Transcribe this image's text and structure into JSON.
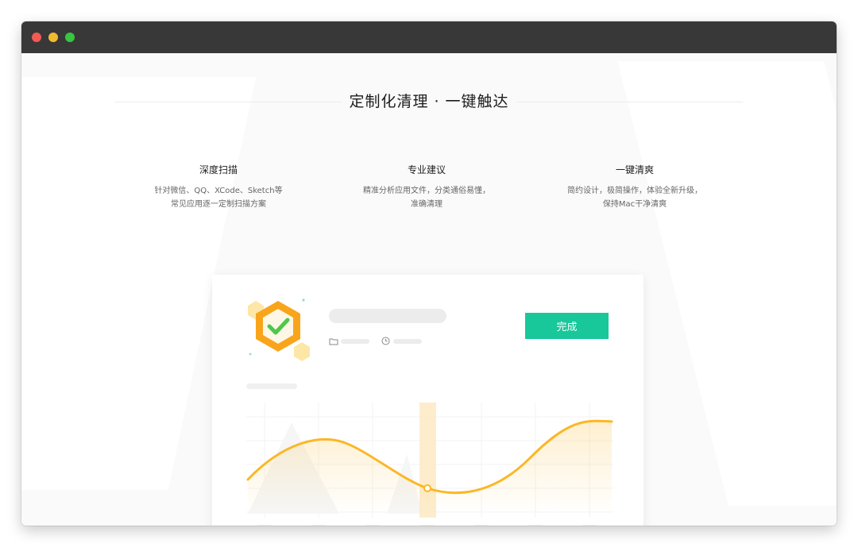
{
  "headline": "定制化清理 · 一键触达",
  "features": [
    {
      "title": "深度扫描",
      "desc_line1": "针对微信、QQ、XCode、Sketch等",
      "desc_line2": "常见应用逐一定制扫描方案"
    },
    {
      "title": "专业建议",
      "desc_line1": "精准分析应用文件，分类通俗易懂，",
      "desc_line2": "准确清理"
    },
    {
      "title": "一键清爽",
      "desc_line1": "简约设计，极简操作，体验全新升级，",
      "desc_line2": "保持Mac干净清爽"
    }
  ],
  "card": {
    "done_button_label": "完成",
    "icons": {
      "folder": "folder-icon",
      "clock": "clock-icon",
      "badge": "check-hexagon-icon"
    }
  },
  "colors": {
    "accent_green": "#18c79a",
    "curve_orange": "#fbb726",
    "badge_orange": "#f8a51c",
    "check_green": "#4cc94a",
    "titlebar": "#383838"
  }
}
